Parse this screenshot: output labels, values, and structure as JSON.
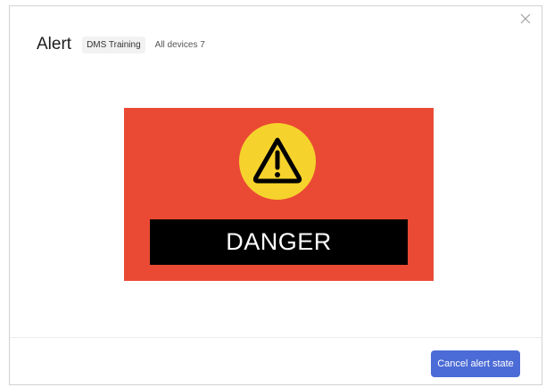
{
  "modal": {
    "title": "Alert",
    "tag": "DMS Training",
    "devices": "All devices 7",
    "close_icon": "close-icon"
  },
  "alert_image": {
    "icon": "warning-triangle-icon",
    "banner_text": "DANGER",
    "background_color": "#ea4a34",
    "circle_color": "#f6d32c"
  },
  "footer": {
    "cancel_label": "Cancel alert state",
    "button_color": "#4b6bd6"
  }
}
